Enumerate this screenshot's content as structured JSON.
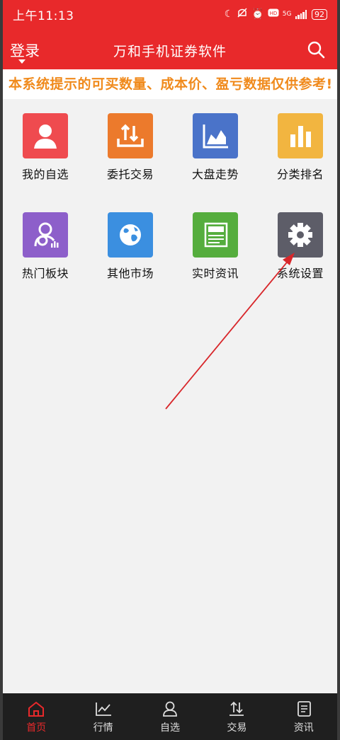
{
  "status_bar": {
    "time": "上午11:13",
    "network": "5G",
    "battery": "92"
  },
  "header": {
    "login_label": "登录",
    "title": "万和手机证券软件",
    "search_icon": "search-icon"
  },
  "notice": "本系统提示的可买数量、成本价、盈亏数据仅供参考!",
  "grid": [
    {
      "label": "我的自选",
      "icon": "user-icon",
      "color": "#ef4b4f"
    },
    {
      "label": "委托交易",
      "icon": "trade-icon",
      "color": "#ec7a2c"
    },
    {
      "label": "大盘走势",
      "icon": "area-chart-icon",
      "color": "#4a73c9"
    },
    {
      "label": "分类排名",
      "icon": "bar-chart-icon",
      "color": "#f2b540"
    },
    {
      "label": "热门板块",
      "icon": "sector-icon",
      "color": "#8d5fca"
    },
    {
      "label": "其他市场",
      "icon": "globe-icon",
      "color": "#3b8fe0"
    },
    {
      "label": "实时资讯",
      "icon": "news-icon",
      "color": "#55ad3d"
    },
    {
      "label": "系统设置",
      "icon": "gear-icon",
      "color": "#5d5d68"
    }
  ],
  "tabs": [
    {
      "label": "首页",
      "icon": "home-icon",
      "active": true
    },
    {
      "label": "行情",
      "icon": "market-chart-icon",
      "active": false
    },
    {
      "label": "自选",
      "icon": "user-outline-icon",
      "active": false
    },
    {
      "label": "交易",
      "icon": "trade-arrows-icon",
      "active": false
    },
    {
      "label": "资讯",
      "icon": "document-icon",
      "active": false
    }
  ],
  "colors": {
    "primary": "#e8292b",
    "notice_text": "#f08a1c",
    "tabbar_bg": "#1f1f1f"
  }
}
